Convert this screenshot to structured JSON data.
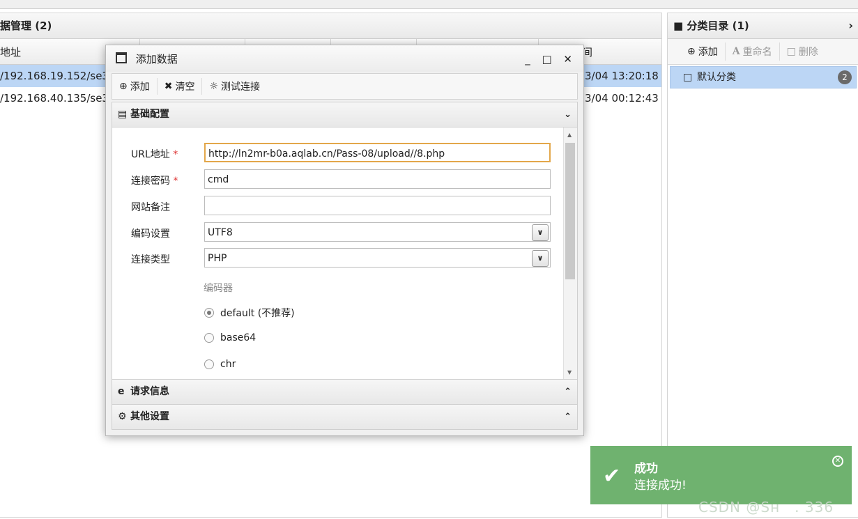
{
  "data_panel": {
    "title": "据管理 (2)",
    "col_address": "地址",
    "col_time": "间",
    "rows": [
      {
        "address": "/192.168.19.152/se3",
        "time": "3/04 13:20:18"
      },
      {
        "address": "/192.168.40.135/se3",
        "time": "3/04 00:12:43"
      }
    ]
  },
  "category_panel": {
    "title": "分类目录 (1)",
    "toolbar": {
      "add": "添加",
      "rename": "重命名",
      "delete": "删除"
    },
    "items": [
      {
        "label": "默认分类",
        "count": "2"
      }
    ]
  },
  "dialog": {
    "title": "添加数据",
    "controls": "_ □ ✕",
    "toolbar": {
      "add": "添加",
      "clear": "清空",
      "test": "测试连接"
    },
    "section_basic": "基础配置",
    "section_request": "请求信息",
    "section_other": "其他设置",
    "form": {
      "url_label": "URL地址",
      "url_value": "http://ln2mr-b0a.aqlab.cn/Pass-08/upload//8.php",
      "password_label": "连接密码",
      "password_value": "cmd",
      "note_label": "网站备注",
      "note_value": "",
      "encoding_label": "编码设置",
      "encoding_value": "UTF8",
      "type_label": "连接类型",
      "type_value": "PHP",
      "encoder_label": "编码器",
      "encoders": [
        "default (不推荐)",
        "base64",
        "chr"
      ],
      "required_mark": "*"
    }
  },
  "toast": {
    "title": "成功",
    "message": "连接成功!"
  },
  "watermark": "CSDN @Sн　.  336"
}
